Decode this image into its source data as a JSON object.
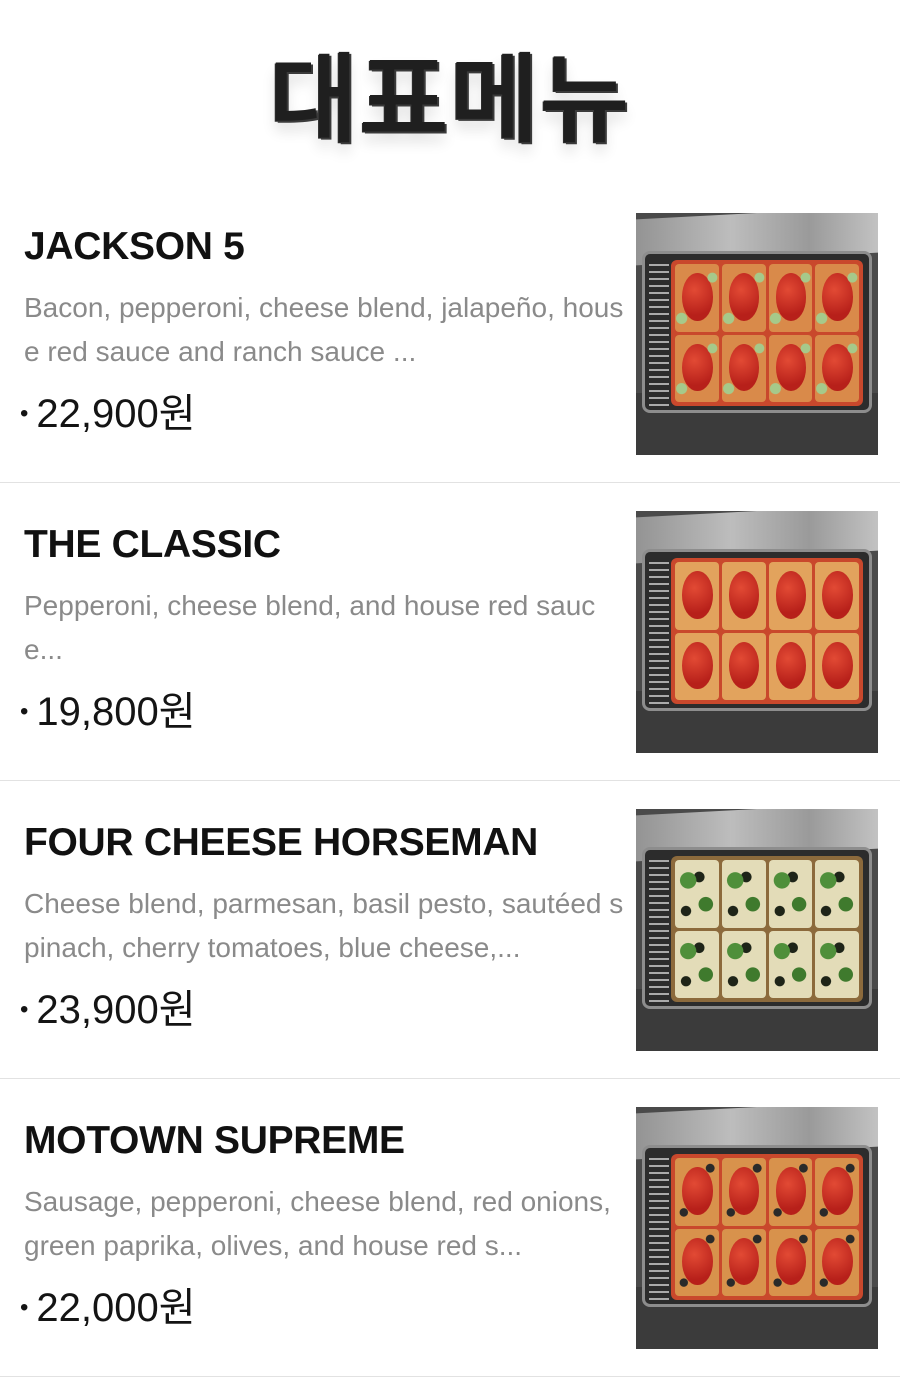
{
  "header": {
    "title": "대표메뉴"
  },
  "menu": {
    "items": [
      {
        "name": "JACKSON 5",
        "description": "Bacon, pepperoni, cheese blend, jalapeño, house red sauce and ranch sauce ...",
        "price": "22,900원",
        "image": "jackson-5-pizza-image"
      },
      {
        "name": "THE CLASSIC",
        "description": "Pepperoni, cheese blend, and house red sauce...",
        "price": "19,800원",
        "image": "the-classic-pizza-image"
      },
      {
        "name": "FOUR CHEESE HORSEMAN",
        "description": "Cheese blend, parmesan, basil pesto, sautéed spinach, cherry tomatoes, blue cheese,...",
        "price": "23,900원",
        "image": "four-cheese-horseman-pizza-image"
      },
      {
        "name": "MOTOWN SUPREME",
        "description": "Sausage, pepperoni, cheese blend, red onions, green paprika, olives, and house red s...",
        "price": "22,000원",
        "image": "motown-supreme-pizza-image"
      }
    ],
    "price_bullet": "•"
  }
}
